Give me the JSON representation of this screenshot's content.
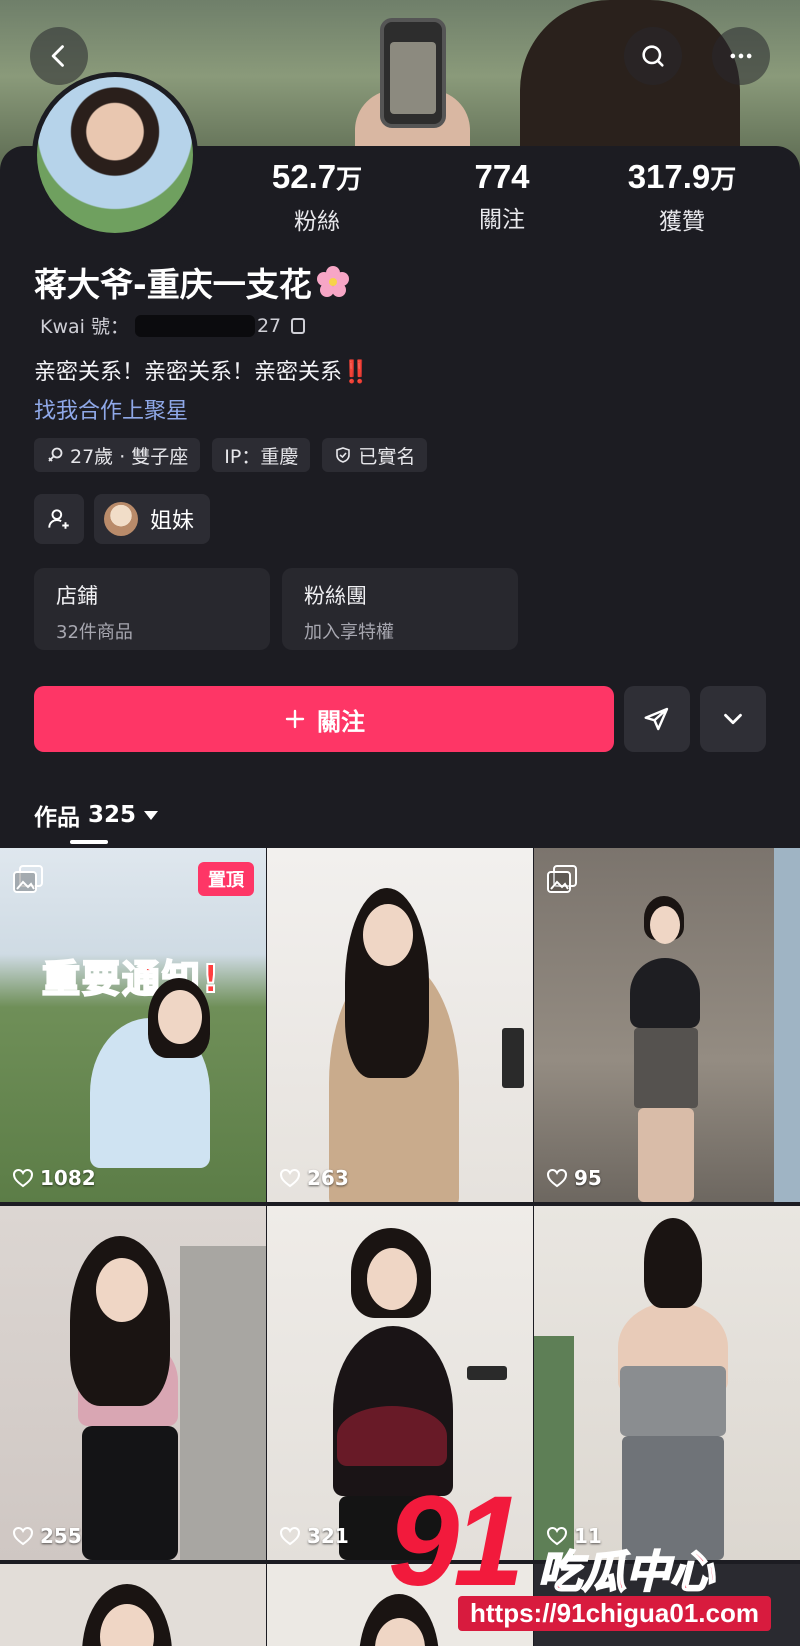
{
  "profile": {
    "followers_num": "52.7",
    "followers_unit": "万",
    "followers_label": "粉絲",
    "following_num": "774",
    "following_label": "關注",
    "likes_num": "317.9",
    "likes_unit": "万",
    "likes_label": "獲贊",
    "name": "蒋大爷-重庆一支花",
    "kwai_label": "Kwai 號：",
    "kwai_tail": "27",
    "bio": "亲密关系！亲密关系！亲密关系",
    "bio_emoji": "‼️",
    "cooperation_link": "找我合作上聚星"
  },
  "tags": {
    "age": "27歲 · 雙子座",
    "ip": "IP：重慶",
    "verified": "已實名"
  },
  "friends": {
    "sister_label": "姐妹"
  },
  "cards": {
    "shop_title": "店鋪",
    "shop_sub": "32件商品",
    "fan_title": "粉絲團",
    "fan_sub": "加入享特權"
  },
  "actions": {
    "follow_label": "關注"
  },
  "works": {
    "label": "作品",
    "count": "325"
  },
  "tiles": [
    {
      "likes": "1082",
      "pinned": "置頂",
      "overlay": "重要通知!"
    },
    {
      "likes": "263"
    },
    {
      "likes": "95"
    },
    {
      "likes": "255"
    },
    {
      "likes": "321"
    },
    {
      "likes": "11"
    }
  ],
  "watermark": {
    "big": "91",
    "cn": "吃瓜中心",
    "url": "https://91chigua01.com"
  },
  "colors": {
    "background": "#1c1c22",
    "accent": "#fe3666",
    "link": "#8fa8e8"
  }
}
